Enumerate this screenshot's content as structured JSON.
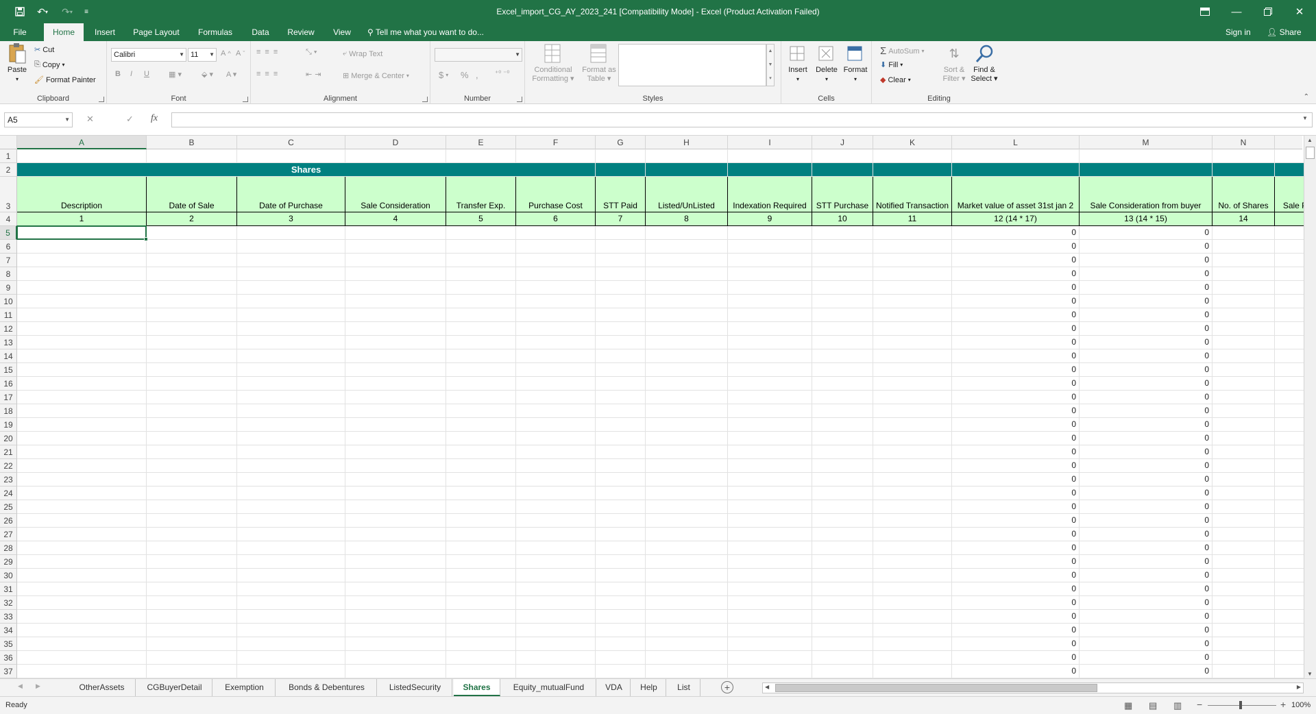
{
  "window": {
    "title": "Excel_import_CG_AY_2023_241  [Compatibility Mode] - Excel (Product Activation Failed)",
    "controls": [
      "ribbon-display-icon",
      "minimize-icon",
      "restore-icon",
      "close-icon"
    ]
  },
  "ribbon_tabs": [
    "File",
    "Home",
    "Insert",
    "Page Layout",
    "Formulas",
    "Data",
    "Review",
    "View"
  ],
  "active_tab": "Home",
  "tell_me": "Tell me what you want to do...",
  "account": {
    "sign_in": "Sign in",
    "share": "Share"
  },
  "clipboard": {
    "paste": "Paste",
    "cut": "Cut",
    "copy": "Copy",
    "format_painter": "Format Painter",
    "label": "Clipboard"
  },
  "font": {
    "name": "Calibri",
    "size": "11",
    "bold": "B",
    "italic": "I",
    "underline": "U",
    "label": "Font"
  },
  "alignment": {
    "wrap_text": "Wrap Text",
    "merge_center": "Merge & Center",
    "label": "Alignment"
  },
  "number": {
    "currency": "$",
    "percent": "%",
    "comma": ",",
    "label": "Number"
  },
  "styles": {
    "conditional_line1": "Conditional",
    "conditional_line2": "Formatting",
    "format_table_line1": "Format as",
    "format_table_line2": "Table",
    "label": "Styles"
  },
  "cells": {
    "insert": "Insert",
    "delete": "Delete",
    "format": "Format",
    "label": "Cells"
  },
  "editing": {
    "autosum": "AutoSum",
    "fill": "Fill",
    "clear": "Clear",
    "sort_line1": "Sort &",
    "sort_line2": "Filter",
    "find_line1": "Find &",
    "find_line2": "Select",
    "label": "Editing"
  },
  "formula_bar": {
    "name_box": "A5",
    "fx": "fx",
    "formula": ""
  },
  "columns": [
    "A",
    "B",
    "C",
    "D",
    "E",
    "F",
    "G",
    "H",
    "I",
    "J",
    "K",
    "L",
    "M",
    "N"
  ],
  "table": {
    "section_title": "Shares",
    "headers": [
      "Description",
      "Date of Sale",
      "Date of Purchase",
      "Sale Consideration",
      "Transfer Exp.",
      "Purchase Cost",
      "STT Paid",
      "Listed/UnListed",
      "Indexation Required",
      "STT Purchase",
      "Notified Transaction",
      "Market value of asset 31st jan 2",
      "Sale Consideration from buyer",
      "No. of Shares",
      "Sale P"
    ],
    "indices": [
      "1",
      "2",
      "3",
      "4",
      "5",
      "6",
      "7",
      "8",
      "9",
      "10",
      "11",
      "12 (14 * 17)",
      "13 (14 * 15)",
      "14",
      ""
    ],
    "first_row": 1,
    "last_row": 37,
    "zero_value": "0"
  },
  "sheet_tabs": [
    "OtherAssets",
    "CGBuyerDetail",
    "Exemption",
    "Bonds & Debentures",
    "ListedSecurity",
    "Shares",
    "Equity_mutualFund",
    "VDA",
    "Help",
    "List"
  ],
  "active_sheet": "Shares",
  "status": {
    "ready": "Ready",
    "zoom": "100%"
  }
}
